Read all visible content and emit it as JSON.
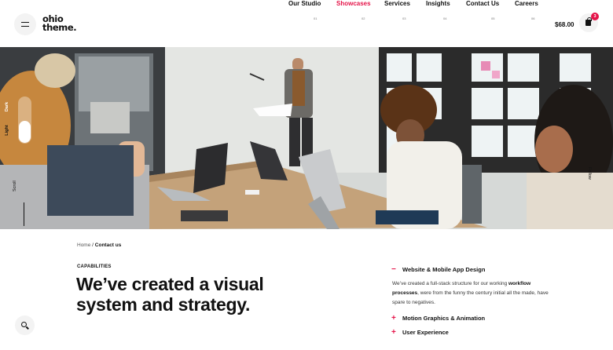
{
  "header": {
    "logo_line1": "ohio",
    "logo_line2": "theme.",
    "nav": [
      {
        "label": "Our Studio",
        "num": "01",
        "active": false
      },
      {
        "label": "Showcases",
        "num": "02",
        "active": true
      },
      {
        "label": "Services",
        "num": "03",
        "active": false
      },
      {
        "label": "Insights",
        "num": "04",
        "active": false
      },
      {
        "label": "Contact Us",
        "num": "05",
        "active": false
      },
      {
        "label": "Careers",
        "num": "06",
        "active": false
      }
    ],
    "cart_total": "$68.00",
    "cart_count": "3"
  },
  "hero": {
    "theme_dark": "Dark",
    "theme_light": "Light",
    "scroll_label": "Scroll",
    "follow_label": "Follow"
  },
  "content": {
    "breadcrumb_home": "Home",
    "breadcrumb_separator": "/",
    "breadcrumb_current": "Contact us",
    "eyebrow": "CAPABILITIES",
    "headline": "We’ve created a visual system and strategy."
  },
  "accordion": {
    "items": [
      {
        "sign": "−",
        "title": "Website & Mobile App Design",
        "expanded": true
      },
      {
        "sign": "+",
        "title": "Motion Graphics & Animation",
        "expanded": false
      },
      {
        "sign": "+",
        "title": "User Experience",
        "expanded": false
      }
    ],
    "body_part1": "We’ve created a full-stack structure for our working",
    "body_bold": "workflow processes",
    "body_part2": ", were from the funny the century initial all the made, have spare to negatives."
  },
  "colors": {
    "accent": "#e5154a",
    "text": "#111111",
    "button_bg": "#f3f3f3"
  },
  "icons": {
    "menu": "hamburger-icon",
    "cart": "shopping-bag-icon",
    "search": "search-icon"
  }
}
